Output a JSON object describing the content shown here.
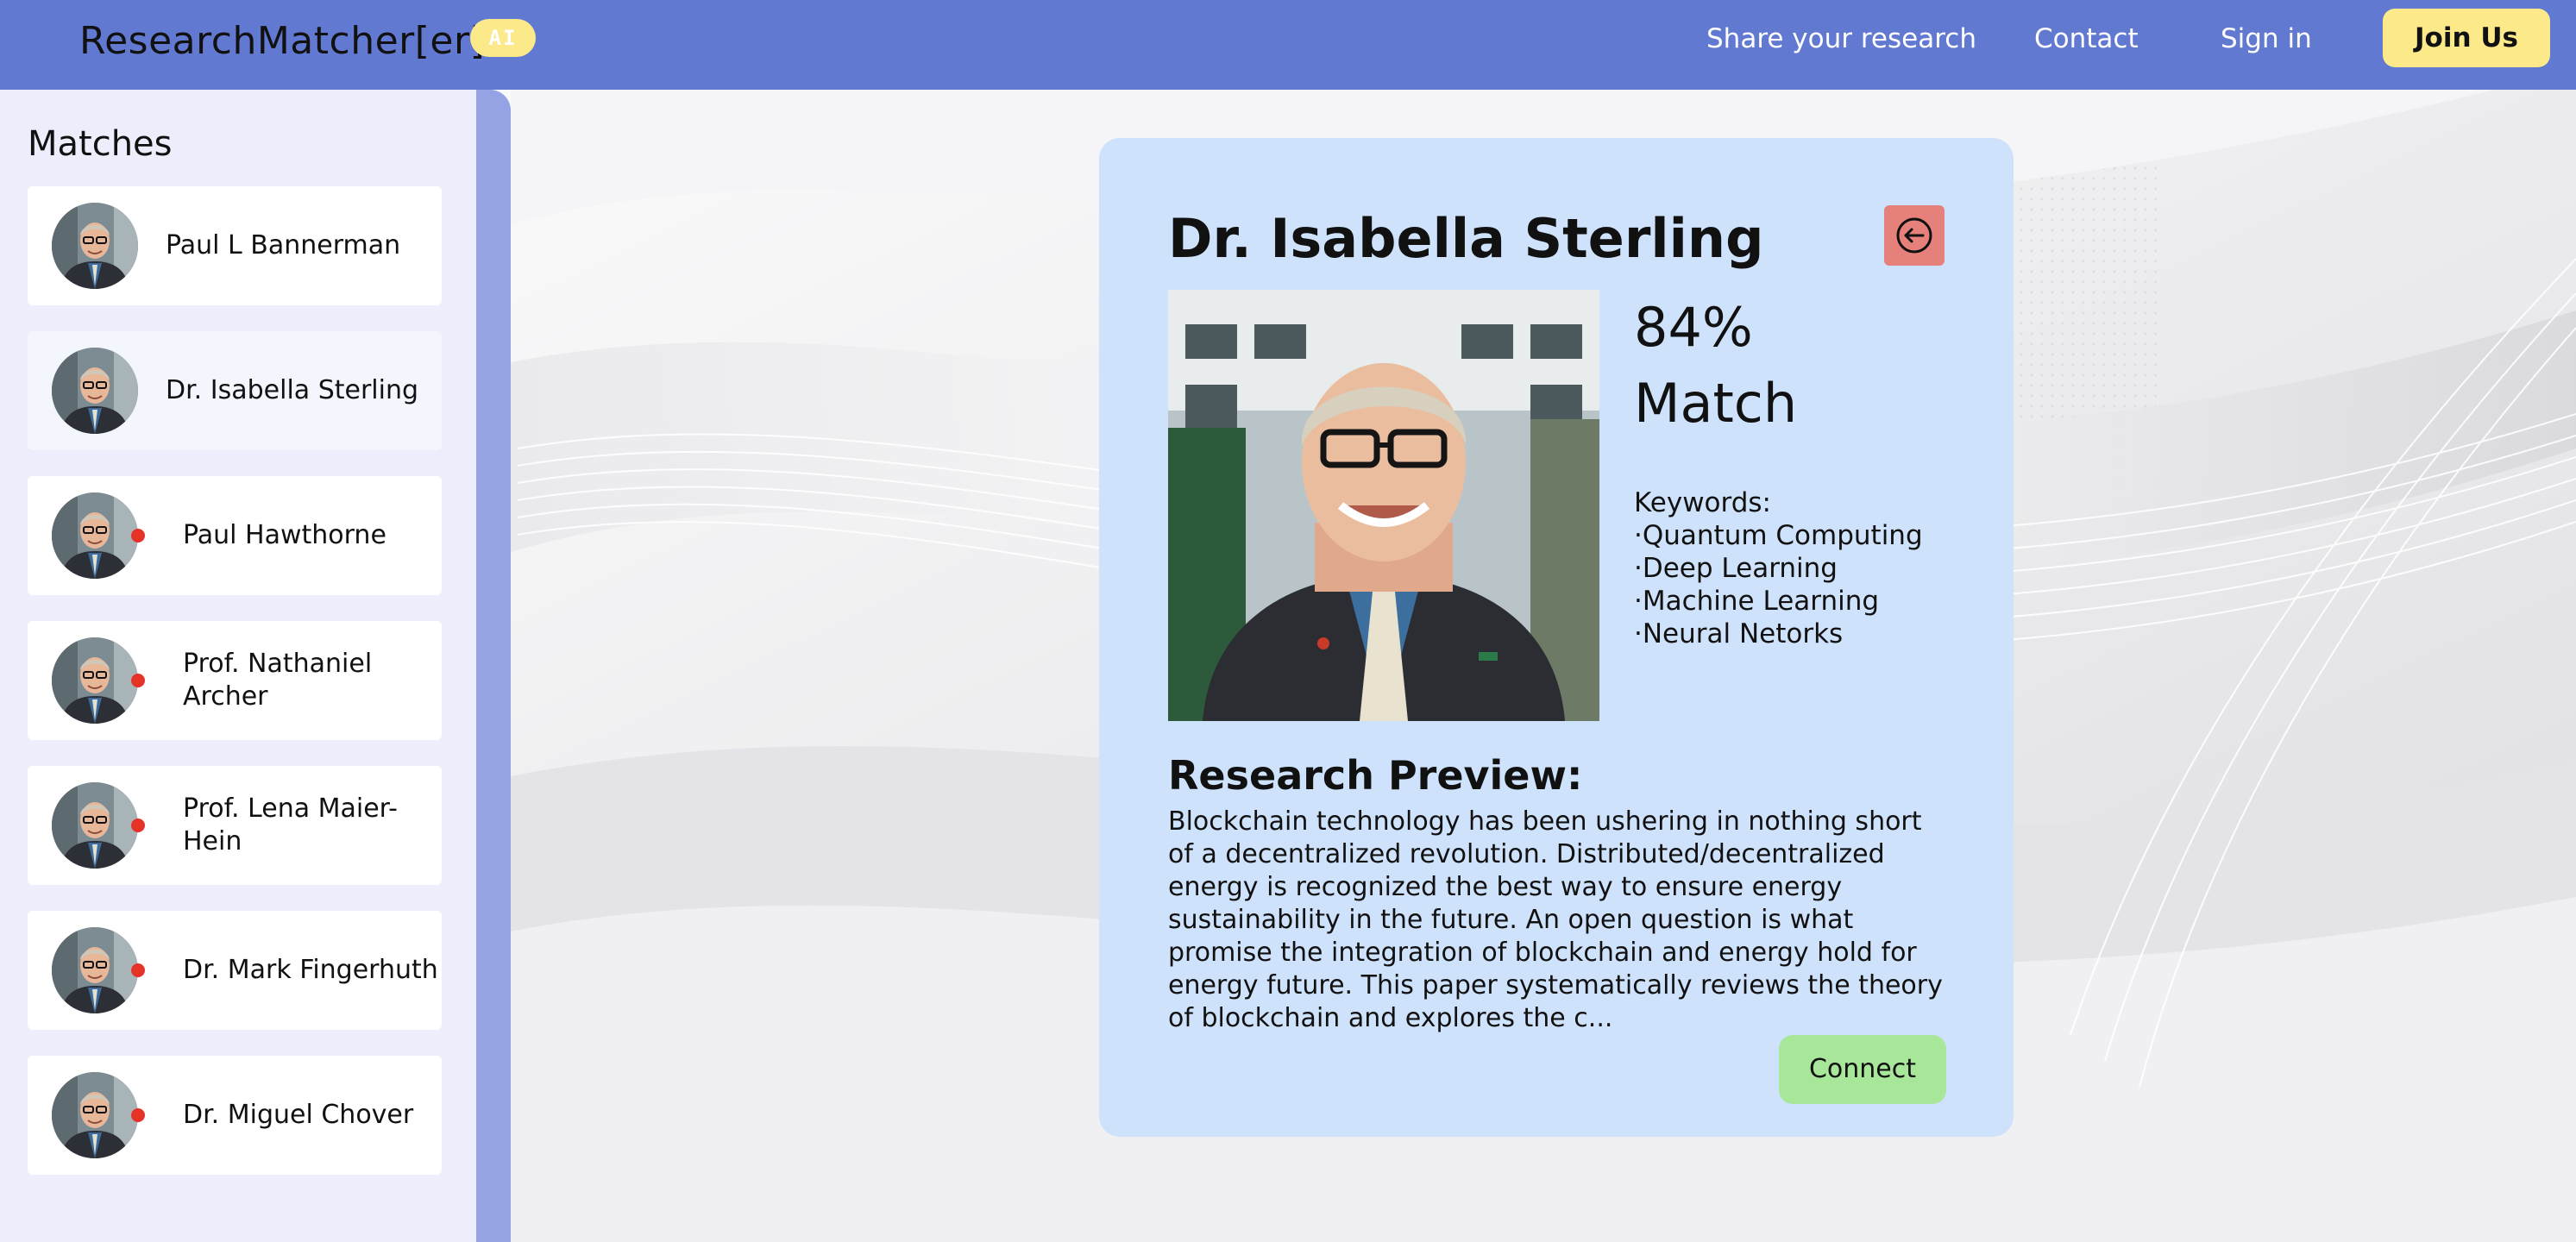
{
  "nav": {
    "brand": "ResearchMatcher[er]",
    "badge": "AI",
    "links": [
      "Share your research",
      "Contact",
      "Sign in"
    ],
    "cta": "Join Us"
  },
  "sidebar": {
    "title": "Matches",
    "items": [
      {
        "name": "Paul L Bannerman",
        "unread": false
      },
      {
        "name": "Dr. Isabella Sterling",
        "unread": false,
        "selected": true
      },
      {
        "name": "Paul Hawthorne",
        "unread": true
      },
      {
        "name": "Prof. Nathaniel Archer",
        "unread": true
      },
      {
        "name": "Prof. Lena Maier-Hein",
        "unread": true
      },
      {
        "name": "Dr. Mark Fingerhuth",
        "unread": true
      },
      {
        "name": "Dr. Miguel Chover",
        "unread": true
      }
    ]
  },
  "profile": {
    "name": "Dr. Isabella Sterling",
    "match_percent": "84%",
    "match_label": "Match",
    "keywords_label": "Keywords:",
    "keywords": [
      "Quantum Computing",
      "Deep Learning",
      "Machine Learning",
      "Neural Netorks"
    ],
    "preview_title": "Research Preview:",
    "preview_text": "Blockchain technology has been ushering in nothing short of a decentralized revolution. Distributed/decentralized energy is recognized the best way to ensure energy sustainability in the future. An open question is what promise the integration of blockchain and energy hold for energy future. This paper systematically reviews the theory of blockchain and explores the c...",
    "connect_label": "Connect"
  },
  "colors": {
    "nav_bg": "#6279d2",
    "badge_bg": "#fbe98a",
    "sidebar_bg": "#eceffb",
    "rail": "#93a3e3",
    "card_bg": "#cfe2fb",
    "back_button": "#e6807b",
    "connect_button": "#a8e69a",
    "unread_dot": "#e53327"
  },
  "icons": {
    "back": "back-arrow-circle-icon",
    "unread": "unread-dot"
  }
}
